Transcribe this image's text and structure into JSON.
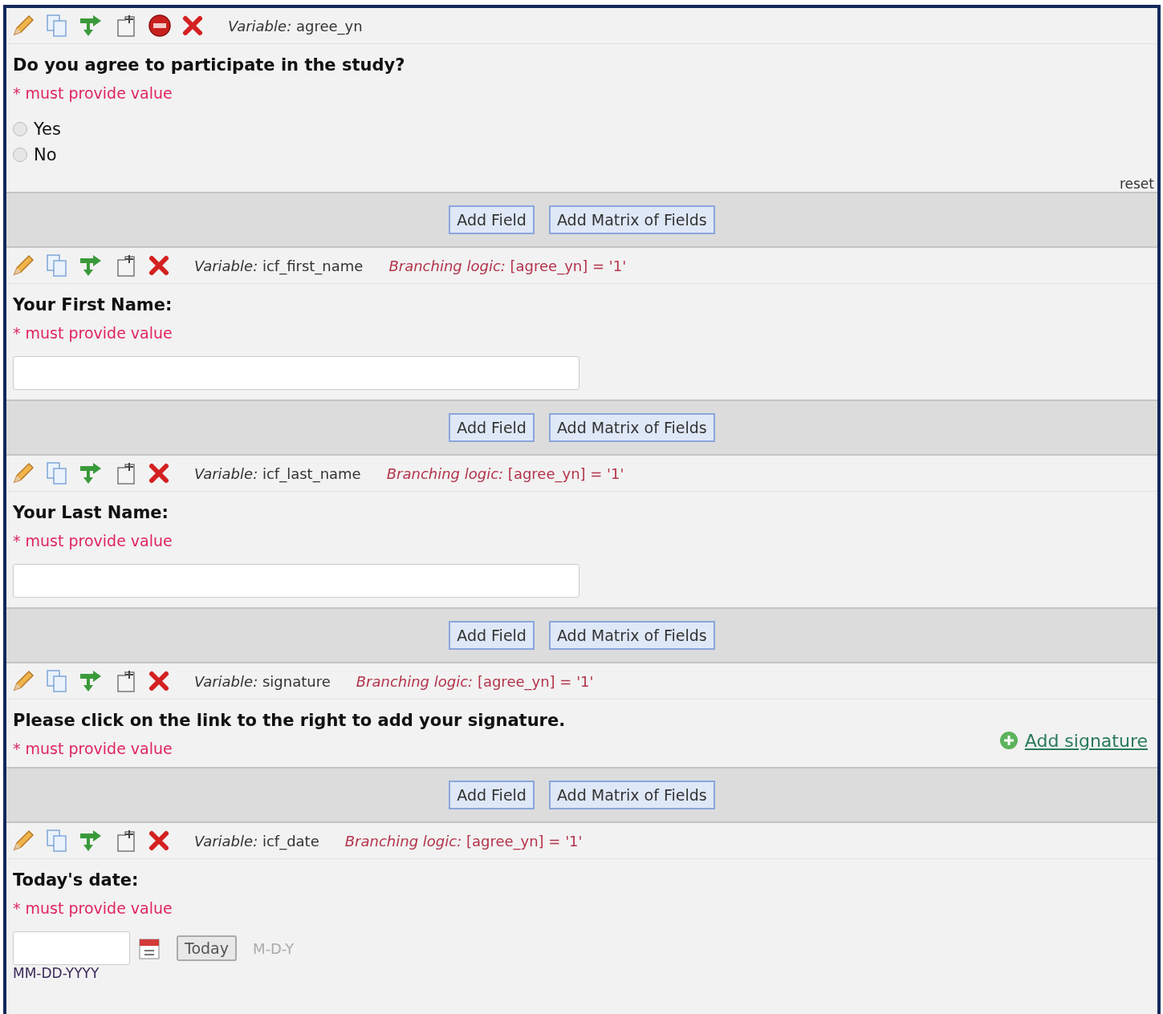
{
  "fields": [
    {
      "kind": "radio",
      "variable_label": "Variable:",
      "variable": "agree_yn",
      "stop_action": true,
      "label": "Do you agree to participate in the study?",
      "required": "* must provide value",
      "choices": [
        {
          "label": "Yes",
          "selected": false
        },
        {
          "label": "No",
          "selected": false
        }
      ],
      "reset": "reset"
    },
    {
      "kind": "add_bar",
      "buttons": [
        "Add Field",
        "Add Matrix of Fields"
      ]
    },
    {
      "kind": "text",
      "variable_label": "Variable:",
      "variable": "icf_first_name",
      "stop_action": false,
      "branching_label": "Branching logic:",
      "branching": "[agree_yn] = '1'",
      "label": "Your First Name:",
      "required": "* must provide value"
    },
    {
      "kind": "add_bar",
      "buttons": [
        "Add Field",
        "Add Matrix of Fields"
      ]
    },
    {
      "kind": "text",
      "variable_label": "Variable:",
      "variable": "icf_last_name",
      "stop_action": false,
      "branching_label": "Branching logic:",
      "branching": "[agree_yn] = '1'",
      "label": "Your Last Name:",
      "required": "* must provide value"
    },
    {
      "kind": "add_bar",
      "buttons": [
        "Add Field",
        "Add Matrix of Fields"
      ]
    },
    {
      "kind": "signature",
      "variable_label": "Variable:",
      "variable": "signature",
      "stop_action": false,
      "branching_label": "Branching logic:",
      "branching": "[agree_yn] = '1'",
      "label": "Please click on the link to the right to add your signature.",
      "required": "* must provide value",
      "link": "Add signature"
    },
    {
      "kind": "add_bar",
      "buttons": [
        "Add Field",
        "Add Matrix of Fields"
      ]
    },
    {
      "kind": "date",
      "variable_label": "Variable:",
      "variable": "icf_date",
      "stop_action": false,
      "branching_label": "Branching logic:",
      "branching": "[agree_yn] = '1'",
      "label": "Today's date:",
      "required": "* must provide value",
      "today_button": "Today",
      "format_hint": "M-D-Y",
      "format": "MM-DD-YYYY"
    }
  ]
}
